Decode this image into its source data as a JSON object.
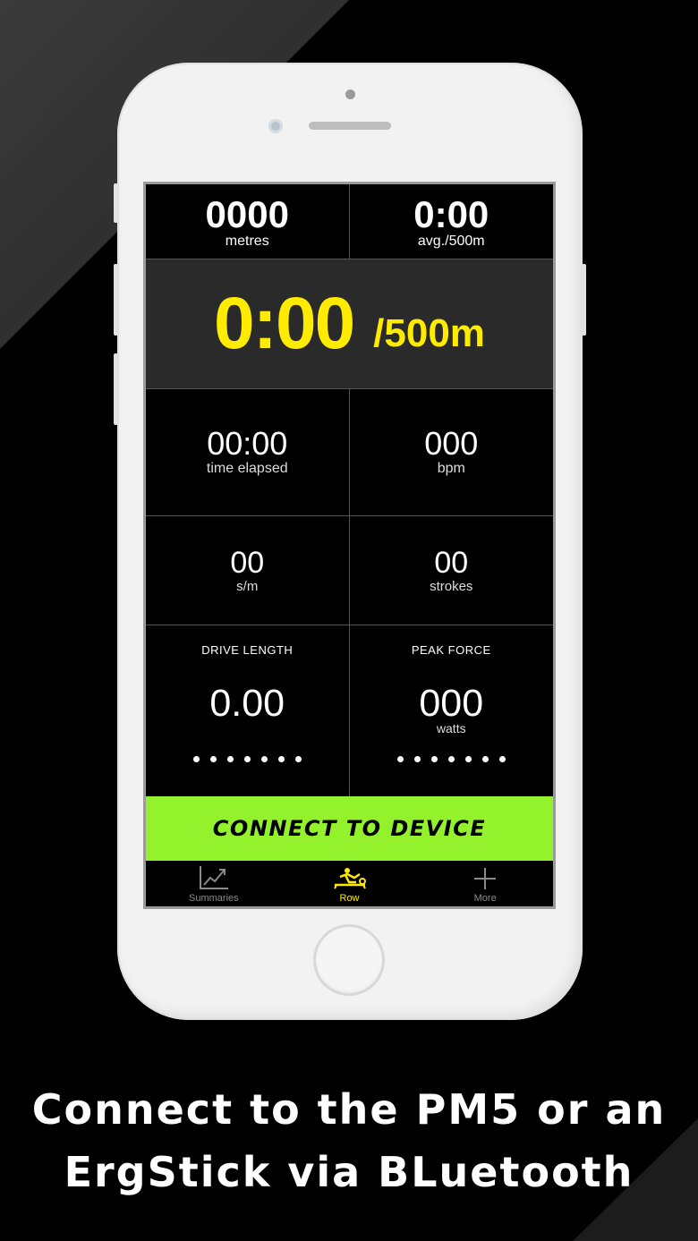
{
  "metrics": {
    "distance": {
      "value": "0000",
      "label": "metres"
    },
    "avg_pace": {
      "value": "0:00",
      "label": "avg./500m"
    },
    "pace": {
      "value": "0:00",
      "unit": "/500m"
    },
    "time_elapsed": {
      "value": "00:00",
      "label": "time elapsed"
    },
    "heart_rate": {
      "value": "000",
      "label": "bpm"
    },
    "stroke_rate": {
      "value": "00",
      "label": "s/m"
    },
    "strokes": {
      "value": "00",
      "label": "strokes"
    },
    "drive_length": {
      "caption": "DRIVE LENGTH",
      "value": "0.00"
    },
    "peak_force": {
      "caption": "PEAK FORCE",
      "value": "000",
      "label": "watts"
    }
  },
  "connect_button": {
    "label": "CONNECT TO DEVICE"
  },
  "tabs": [
    {
      "label": "Summaries",
      "icon": "chart-icon"
    },
    {
      "label": "Row",
      "icon": "rower-icon"
    },
    {
      "label": "More",
      "icon": "plus-icon"
    }
  ],
  "headline": {
    "line1": "Connect to the PM5 or an",
    "line2": "ErgStick via BLuetooth"
  },
  "colors": {
    "accent_yellow": "#ffeb00",
    "connect_green": "#94f22d",
    "background": "#000000"
  }
}
